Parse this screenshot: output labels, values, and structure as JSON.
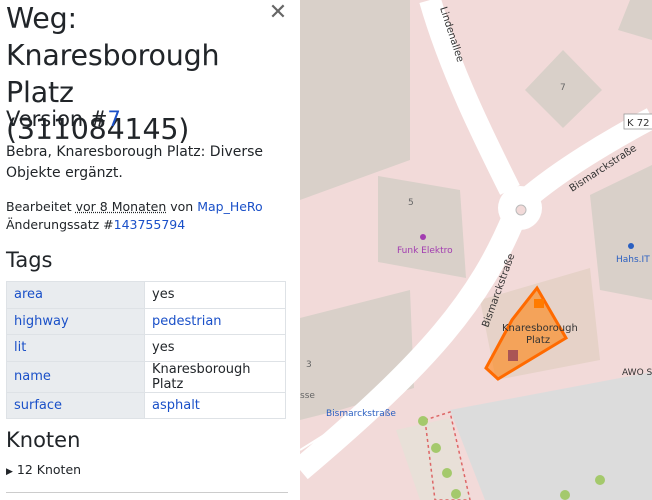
{
  "sidebar": {
    "title_line1": "Weg:",
    "title_line2": "Knaresborough",
    "title_line3": "Platz (311084145)",
    "version_prefix": "Version #",
    "version_number": "7",
    "description_line1": "Bebra, Knaresborough Platz: Diverse",
    "description_line2": "Objekte ergänzt.",
    "edited_prefix": "Bearbeitet ",
    "edited_ago": "vor 8 Monaten",
    "edited_by_word": " von ",
    "editor": "Map_HeRo",
    "changeset_prefix": "Änderungssatz #",
    "changeset_id": "143755794",
    "tags_heading": "Tags",
    "tags": [
      {
        "key": "area",
        "value": "yes"
      },
      {
        "key": "highway",
        "value": "pedestrian"
      },
      {
        "key": "lit",
        "value": "yes"
      },
      {
        "key": "name",
        "value": "Knaresborough Platz"
      },
      {
        "key": "surface",
        "value": "asphalt"
      }
    ],
    "nodes_heading": "Knoten",
    "nodes_summary": "12 Knoten",
    "close_icon": "close-icon"
  },
  "map": {
    "street_lindenallee": "Lindenallee",
    "street_bismarckstrasse_1": "Bismarckstraße",
    "street_bismarckstrasse_2": "Bismarckstraße",
    "street_bismarckstrasse_3": "Bismarckstraße",
    "road_ref": "K 72",
    "house_7": "7",
    "house_5": "5",
    "house_3": "3",
    "poi_funk": "Funk Elektro",
    "poi_hahs": "Hahs.IT",
    "poi_awo": "AWO Sc",
    "partial_label": "sse",
    "highlight_label_line1": "Knaresborough",
    "highlight_label_line2": "Platz",
    "colors": {
      "background": "#f2dad9",
      "building": "#d9d0c9",
      "road": "#ffffff",
      "highlight": "#ff7b00",
      "link": "#1a50c8"
    }
  }
}
